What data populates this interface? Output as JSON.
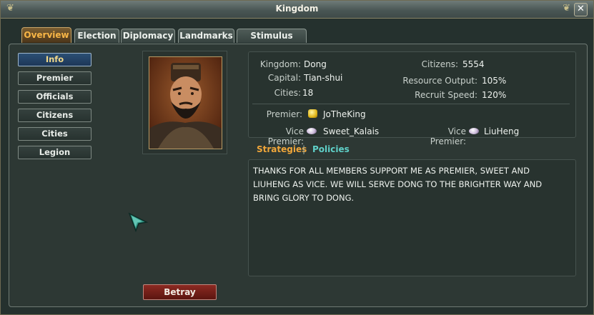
{
  "window": {
    "title": "Kingdom",
    "close_label": "✕"
  },
  "tabs": [
    "Overview",
    "Election",
    "Diplomacy",
    "Landmarks",
    "Stimulus Tasks"
  ],
  "sidebar": [
    "Info",
    "Premier",
    "Officials",
    "Citizens",
    "Cities",
    "Legion"
  ],
  "info": {
    "kingdom_label": "Kingdom:",
    "kingdom": "Dong",
    "capital_label": "Capital:",
    "capital": "Tian-shui",
    "cities_label": "Cities:",
    "cities": "18",
    "citizens_label": "Citizens:",
    "citizens": "5554",
    "resource_label": "Resource Output:",
    "resource": "105%",
    "recruit_label": "Recruit Speed:",
    "recruit": "120%",
    "premier_label": "Premier:",
    "premier": "JoTheKing",
    "vice_label": "Vice Premier:",
    "vice1": "Sweet_Kalais",
    "vice2": "LiuHeng"
  },
  "subtabs": {
    "strategies": "Strategies",
    "sep": "|",
    "policies": "Policies"
  },
  "announcement": "THANKS FOR ALL MEMBERS SUPPORT ME AS PREMIER, SWEET AND LIUHENG AS VICE. WE WILL SERVE DONG TO THE BRIGHTER WAY AND BRING GLORY TO DONG.",
  "actions": {
    "betray": "Betray"
  },
  "colors": {
    "active_tab": "#f8b646",
    "active_side": "#1d3758",
    "strategies": "#f0a63a",
    "policies": "#5fd0c8"
  }
}
